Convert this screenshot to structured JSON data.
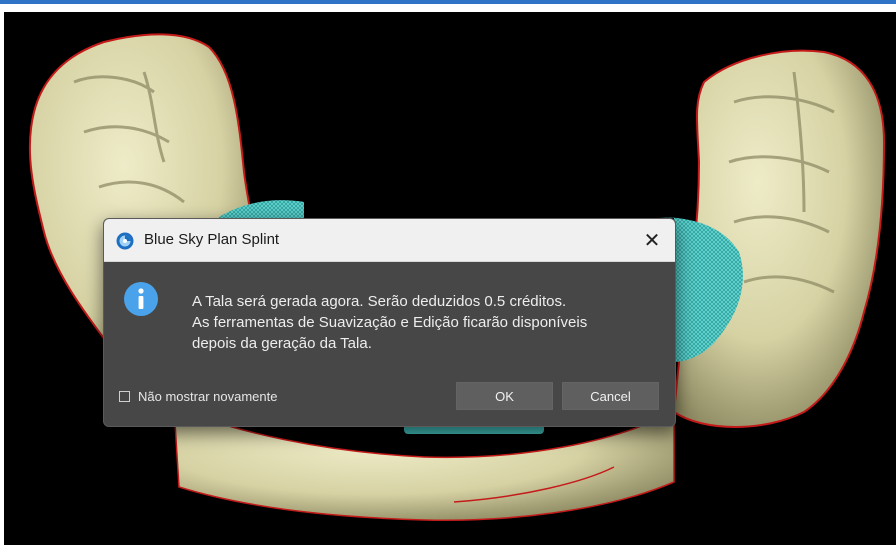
{
  "dialog": {
    "title": "Blue Sky Plan Splint",
    "close_label": "✕",
    "message_lines": [
      "A Tala será gerada agora. Serão deduzidos 0.5 créditos.",
      "As ferramentas de Suavização e Edição ficarão disponíveis",
      "depois da geração da Tala."
    ],
    "checkbox_label": "Não mostrar novamente",
    "checkbox_checked": false,
    "ok_label": "OK",
    "cancel_label": "Cancel"
  },
  "colors": {
    "accent_bar": "#2f74c6",
    "model_bone": "#dcd8ae",
    "model_outline": "#d01818",
    "splint_teal": "#3fb8b4",
    "info_icon": "#4aa3ea"
  },
  "icons": {
    "app": "blue-sky-plan-logo-icon",
    "info": "info-icon",
    "close": "close-icon"
  }
}
